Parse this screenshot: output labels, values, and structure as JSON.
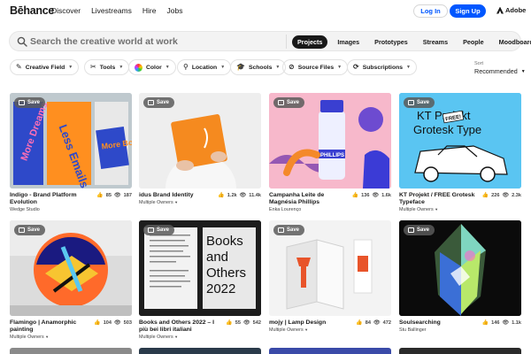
{
  "nav": {
    "logo": "Bēhance",
    "links": [
      "Discover",
      "Livestreams",
      "Hire",
      "Jobs"
    ],
    "login": "Log In",
    "signup": "Sign Up",
    "adobe": "Adobe"
  },
  "search": {
    "placeholder": "Search the creative world at work",
    "tabs": [
      "Projects",
      "Images",
      "Prototypes",
      "Streams",
      "People",
      "Moodboards"
    ],
    "active_tab": "Projects"
  },
  "filters": {
    "chips": [
      {
        "label": "Creative Field",
        "icon": "creative-field-icon"
      },
      {
        "label": "Tools",
        "icon": "tools-icon"
      },
      {
        "label": "Color",
        "icon": "color-wheel-icon"
      },
      {
        "label": "Location",
        "icon": "location-pin-icon"
      },
      {
        "label": "Schools",
        "icon": "schools-icon"
      },
      {
        "label": "Source Files",
        "icon": "source-files-icon"
      },
      {
        "label": "Subscriptions",
        "icon": "subscriptions-icon"
      }
    ],
    "sort_label": "Sort",
    "sort_value": "Recommended"
  },
  "cards": [
    {
      "title": "Indigo - Brand Platform Evolution",
      "owner": "Wedge Studio",
      "likes": "85",
      "views": "187",
      "save": "Save"
    },
    {
      "title": "idus Brand Identity",
      "owner": "Multiple Owners",
      "likes": "1.2k",
      "views": "11.4k",
      "save": "Save"
    },
    {
      "title": "Campanha Leite de Magnésia Phillips",
      "owner": "Enka Lourenço",
      "likes": "136",
      "views": "1.6k",
      "save": "Save"
    },
    {
      "title": "KT Projekt / FREE Grotesk Typeface",
      "owner": "Multiple Owners",
      "likes": "226",
      "views": "2.3k",
      "save": "Save"
    },
    {
      "title": "Flamingo | Anamorphic painting",
      "owner": "Multiple Owners",
      "likes": "104",
      "views": "503",
      "save": "Save"
    },
    {
      "title": "Books and Others 2022 – I più bei libri italiani",
      "owner": "Multiple Owners",
      "likes": "55",
      "views": "542",
      "save": "Save"
    },
    {
      "title": "mojy | Lamp Design",
      "owner": "Multiple Owners",
      "likes": "84",
      "views": "472",
      "save": "Save"
    },
    {
      "title": "Soulsearching",
      "owner": "Stu Ballinger",
      "likes": "146",
      "views": "1.1k",
      "save": "Save"
    }
  ],
  "artwork_text": {
    "indigo_1": "More Dreams",
    "indigo_2": "Less Emails",
    "indigo_3": "More Books",
    "phillips_label": "PHILLIPS",
    "kt_1": "KT Projekt",
    "kt_2": "Grotesk Type",
    "kt_free": "FREE!",
    "books_1": "Books",
    "books_2": "and",
    "books_3": "Others",
    "books_4": "2022"
  },
  "colors": {
    "brand_blue": "#0057ff",
    "text_dark": "#191919"
  }
}
